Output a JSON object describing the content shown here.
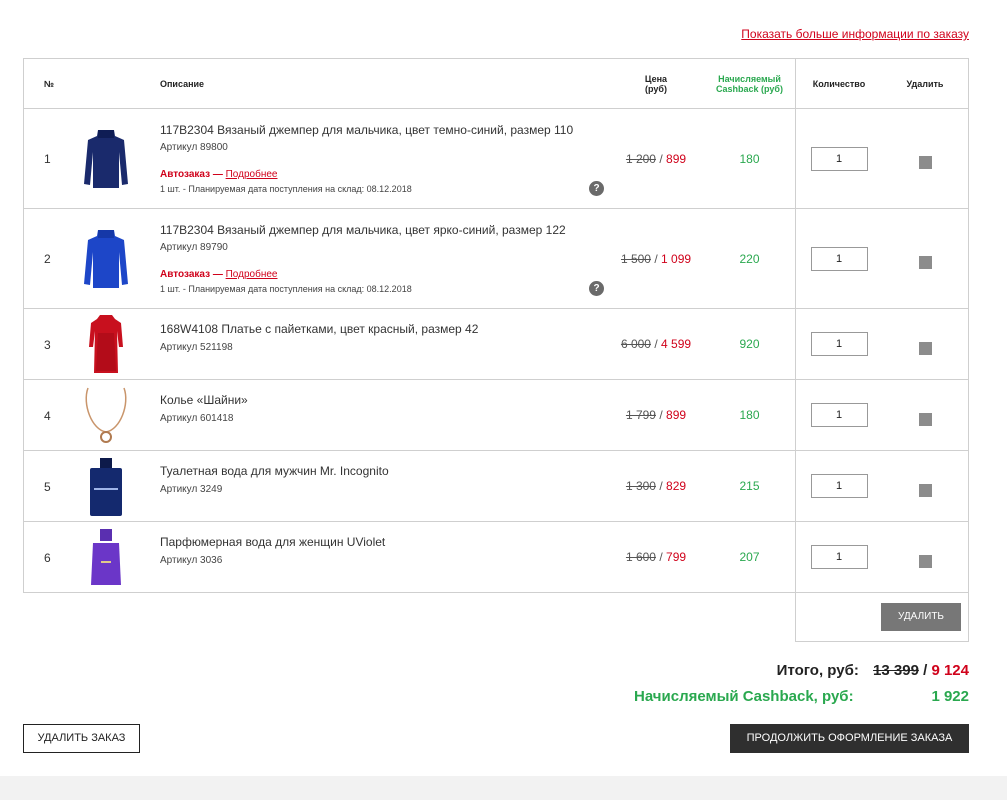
{
  "more_info_link": "Показать больше информации по заказу",
  "headers": {
    "num": "№",
    "desc": "Описание",
    "price": "Цена (руб)",
    "cashback": "Начисляемый Cashback (руб)",
    "qty": "Количество",
    "delete": "Удалить"
  },
  "items": [
    {
      "num": "1",
      "title": "117B2304 Вязаный джемпер для мальчика, цвет темно-синий, размер 110",
      "article": "Артикул 89800",
      "auto_label": "Автозаказ —",
      "auto_link": "Подробнее",
      "plan": "1 шт. - Планируемая дата поступления на склад: 08.12.2018",
      "old_price": "1 200",
      "new_price": "899",
      "cashback": "180",
      "qty": "1",
      "image": "sweater-navy"
    },
    {
      "num": "2",
      "title": "117B2304 Вязаный джемпер для мальчика, цвет ярко-синий, размер 122",
      "article": "Артикул 89790",
      "auto_label": "Автозаказ —",
      "auto_link": "Подробнее",
      "plan": "1 шт. - Планируемая дата поступления на склад: 08.12.2018",
      "old_price": "1 500",
      "new_price": "1 099",
      "cashback": "220",
      "qty": "1",
      "image": "sweater-blue"
    },
    {
      "num": "3",
      "title": "168W4108 Платье с пайетками, цвет красный, размер 42",
      "article": "Артикул 521198",
      "old_price": "6 000",
      "new_price": "4 599",
      "cashback": "920",
      "qty": "1",
      "image": "dress-red"
    },
    {
      "num": "4",
      "title": "Колье «Шайни»",
      "article": "Артикул 601418",
      "old_price": "1 799",
      "new_price": "899",
      "cashback": "180",
      "qty": "1",
      "image": "necklace"
    },
    {
      "num": "5",
      "title": "Туалетная вода для мужчин Mr. Incognito",
      "article": "Артикул 3249",
      "old_price": "1 300",
      "new_price": "829",
      "cashback": "215",
      "qty": "1",
      "image": "perfume-blue"
    },
    {
      "num": "6",
      "title": "Парфюмерная вода для женщин UViolet",
      "article": "Артикул 3036",
      "old_price": "1 600",
      "new_price": "799",
      "cashback": "207",
      "qty": "1",
      "image": "perfume-violet"
    }
  ],
  "delete_button": "УДАЛИТЬ",
  "totals": {
    "label": "Итого, руб:",
    "old": "13 399",
    "sep": "/",
    "new": "9 124",
    "cashback_label": "Начисляемый Cashback, руб:",
    "cashback_value": "1 922"
  },
  "cancel_button": "УДАЛИТЬ ЗАКАЗ",
  "continue_button": "ПРОДОЛЖИТЬ ОФОРМЛЕНИЕ ЗАКАЗА",
  "help_glyph": "?",
  "colors": {
    "accent_red": "#d0021b",
    "cashback_green": "#2aa84f",
    "dark_button": "#2f2f2f"
  }
}
